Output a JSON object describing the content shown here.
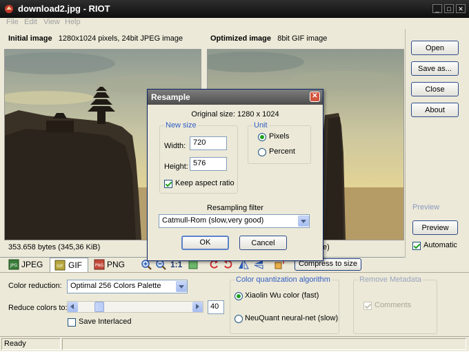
{
  "window": {
    "title": "download2.jpg - RIOT"
  },
  "menu": [
    "File",
    "Edit",
    "View",
    "Help"
  ],
  "initial": {
    "title": "Initial image",
    "info": "1280x1024 pixels, 24bit JPEG image",
    "size": "353.658 bytes (345,36 KiB)"
  },
  "optimized": {
    "title": "Optimized image",
    "info": "8bit GIF image",
    "size_tail": "e)"
  },
  "side_buttons": {
    "open": "Open",
    "save": "Save as...",
    "close": "Close",
    "about": "About"
  },
  "preview": {
    "group_title": "Preview",
    "button": "Preview",
    "automatic": "Automatic",
    "automatic_checked": true
  },
  "tabs": {
    "jpeg": "JPEG",
    "gif": "GIF",
    "png": "PNG",
    "active": "GIF"
  },
  "toolbar": {
    "ratio": "1:1",
    "compress": "Compress to size"
  },
  "color_reduction": {
    "label": "Color reduction:",
    "value": "Optimal 256 Colors Palette"
  },
  "reduce_colors": {
    "label": "Reduce colors to:",
    "value": "40"
  },
  "interlaced": {
    "label": "Save Interlaced",
    "checked": false
  },
  "quantization": {
    "title": "Color quantization algorithm",
    "option1": "Xiaolin Wu color (fast)",
    "option2": "NeuQuant neural-net (slow)",
    "selected": "Xiaolin Wu color (fast)"
  },
  "metadata": {
    "title": "Remove Metadata",
    "comments": "Comments",
    "comments_checked": true
  },
  "status": {
    "text": "Ready"
  },
  "dialog": {
    "title": "Resample",
    "original_size": "Original size: 1280 x 1024",
    "new_size_title": "New size",
    "width_label": "Width:",
    "width_value": "720",
    "height_label": "Height:",
    "height_value": "576",
    "keep_aspect": "Keep aspect ratio",
    "keep_aspect_checked": true,
    "unit_title": "Unit",
    "pixels": "Pixels",
    "percent": "Percent",
    "unit_selected": "Pixels",
    "filter_label": "Resampling filter",
    "filter_value": "Catmull-Rom (slow,very good)",
    "ok": "OK",
    "cancel": "Cancel"
  }
}
